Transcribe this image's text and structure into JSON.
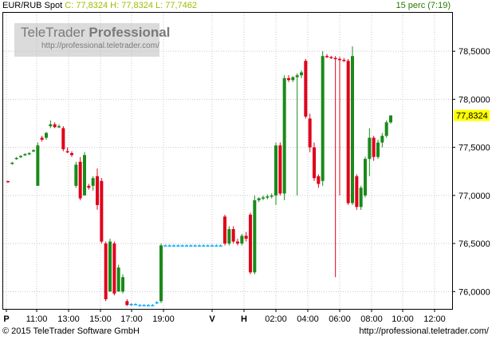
{
  "header": {
    "symbol": "EUR/RUB Spot",
    "quote": "C: 77,8324 H: 77,8324 L: 77,7462",
    "interval": "15 perc (7:19)"
  },
  "logo": {
    "name_regular": "TeleTrader ",
    "name_bold": "Professional",
    "url": "http://professional.teletrader.com/"
  },
  "footer": {
    "copyright": "© 2015 TeleTrader Software GmbH",
    "url": "http://professional.teletrader.com/"
  },
  "colors": {
    "up": "#1a8a1a",
    "down": "#e0001a",
    "doji": "#00aaff",
    "grid": "#c8c8c8",
    "price_highlight": "#ffff00"
  },
  "chart_data": {
    "type": "candlestick",
    "y_ticks": [
      "78,5000",
      "78,0000",
      "77,5000",
      "77,0000",
      "76,5000",
      "76,0000"
    ],
    "y_tick_values": [
      78.5,
      78.0,
      77.5,
      77.0,
      76.5,
      76.0
    ],
    "ylim": [
      75.82,
      78.9
    ],
    "current_price": "77,8324",
    "current_price_value": 77.8324,
    "x_tick_labels": [
      "P",
      "11:00",
      "13:00",
      "15:00",
      "17:00",
      "19:00",
      "V",
      "H",
      "02:00",
      "04:00",
      "06:00",
      "08:00",
      "10:00",
      "12:00"
    ],
    "grid": true,
    "candles": [
      {
        "o": 77.15,
        "h": 77.15,
        "l": 77.13,
        "c": 77.14
      },
      {
        "o": 77.33,
        "h": 77.35,
        "l": 77.32,
        "c": 77.34
      },
      {
        "o": 77.38,
        "h": 77.4,
        "l": 77.37,
        "c": 77.39
      },
      {
        "o": 77.4,
        "h": 77.42,
        "l": 77.39,
        "c": 77.41
      },
      {
        "o": 77.42,
        "h": 77.44,
        "l": 77.41,
        "c": 77.43
      },
      {
        "o": 77.43,
        "h": 77.45,
        "l": 77.42,
        "c": 77.44
      },
      {
        "o": 77.46,
        "h": 77.48,
        "l": 77.45,
        "c": 77.47
      },
      {
        "o": 77.1,
        "h": 77.55,
        "l": 77.1,
        "c": 77.52
      },
      {
        "o": 77.6,
        "h": 77.62,
        "l": 77.56,
        "c": 77.58
      },
      {
        "o": 77.6,
        "h": 77.66,
        "l": 77.58,
        "c": 77.65
      },
      {
        "o": 77.72,
        "h": 77.78,
        "l": 77.7,
        "c": 77.74
      },
      {
        "o": 77.74,
        "h": 77.76,
        "l": 77.7,
        "c": 77.71
      },
      {
        "o": 77.72,
        "h": 77.74,
        "l": 77.7,
        "c": 77.72
      },
      {
        "o": 77.7,
        "h": 77.72,
        "l": 77.46,
        "c": 77.48
      },
      {
        "o": 77.46,
        "h": 77.5,
        "l": 77.44,
        "c": 77.45
      },
      {
        "o": 77.44,
        "h": 77.46,
        "l": 77.4,
        "c": 77.42
      },
      {
        "o": 77.1,
        "h": 77.35,
        "l": 77.08,
        "c": 77.32
      },
      {
        "o": 77.35,
        "h": 77.4,
        "l": 76.95,
        "c": 76.97
      },
      {
        "o": 77.0,
        "h": 77.45,
        "l": 77.0,
        "c": 77.42
      },
      {
        "o": 77.1,
        "h": 77.12,
        "l": 77.06,
        "c": 77.08
      },
      {
        "o": 77.1,
        "h": 77.2,
        "l": 77.05,
        "c": 77.18
      },
      {
        "o": 77.2,
        "h": 77.28,
        "l": 76.85,
        "c": 76.9
      },
      {
        "o": 77.15,
        "h": 77.18,
        "l": 76.5,
        "c": 76.52
      },
      {
        "o": 76.5,
        "h": 76.52,
        "l": 75.9,
        "c": 75.92
      },
      {
        "o": 76.0,
        "h": 76.55,
        "l": 76.0,
        "c": 76.52
      },
      {
        "o": 76.5,
        "h": 76.52,
        "l": 75.96,
        "c": 75.98
      },
      {
        "o": 76.0,
        "h": 76.28,
        "l": 76.0,
        "c": 76.25
      },
      {
        "o": 76.0,
        "h": 76.18,
        "l": 75.98,
        "c": 76.15
      },
      {
        "o": 75.9,
        "h": 75.92,
        "l": 75.85,
        "c": 75.86
      },
      {
        "o": 75.87,
        "h": 75.88,
        "l": 75.85,
        "c": 75.86
      },
      {
        "o": 75.87,
        "h": 75.88,
        "l": 75.86,
        "c": 75.87
      },
      {
        "o": 75.86,
        "h": 75.87,
        "l": 75.85,
        "c": 75.86
      },
      {
        "o": 75.86,
        "h": 75.87,
        "l": 75.85,
        "c": 75.86
      },
      {
        "o": 75.86,
        "h": 75.87,
        "l": 75.85,
        "c": 75.86
      },
      {
        "o": 75.86,
        "h": 75.87,
        "l": 75.85,
        "c": 75.86
      },
      {
        "o": 75.88,
        "h": 75.9,
        "l": 75.87,
        "c": 75.89
      },
      {
        "o": 75.9,
        "h": 76.5,
        "l": 75.88,
        "c": 76.48
      },
      {
        "o": 76.48,
        "h": 76.49,
        "l": 76.47,
        "c": 76.48
      },
      {
        "o": 76.48,
        "h": 76.49,
        "l": 76.47,
        "c": 76.48
      },
      {
        "o": 76.48,
        "h": 76.49,
        "l": 76.47,
        "c": 76.48
      },
      {
        "o": 76.48,
        "h": 76.49,
        "l": 76.47,
        "c": 76.48
      },
      {
        "o": 76.48,
        "h": 76.49,
        "l": 76.47,
        "c": 76.48
      },
      {
        "o": 76.48,
        "h": 76.49,
        "l": 76.47,
        "c": 76.48
      },
      {
        "o": 76.48,
        "h": 76.49,
        "l": 76.47,
        "c": 76.48
      },
      {
        "o": 76.48,
        "h": 76.49,
        "l": 76.47,
        "c": 76.48
      },
      {
        "o": 76.48,
        "h": 76.49,
        "l": 76.47,
        "c": 76.48
      },
      {
        "o": 76.48,
        "h": 76.49,
        "l": 76.47,
        "c": 76.48
      },
      {
        "o": 76.48,
        "h": 76.49,
        "l": 76.47,
        "c": 76.48
      },
      {
        "o": 76.48,
        "h": 76.49,
        "l": 76.47,
        "c": 76.48
      },
      {
        "o": 76.48,
        "h": 76.49,
        "l": 76.47,
        "c": 76.48
      },
      {
        "o": 76.48,
        "h": 76.49,
        "l": 76.47,
        "c": 76.48
      },
      {
        "o": 76.78,
        "h": 76.8,
        "l": 76.48,
        "c": 76.5
      },
      {
        "o": 76.5,
        "h": 76.68,
        "l": 76.48,
        "c": 76.65
      },
      {
        "o": 76.65,
        "h": 76.68,
        "l": 76.5,
        "c": 76.52
      },
      {
        "o": 76.52,
        "h": 76.55,
        "l": 76.48,
        "c": 76.5
      },
      {
        "o": 76.5,
        "h": 76.6,
        "l": 76.48,
        "c": 76.58
      },
      {
        "o": 76.58,
        "h": 76.62,
        "l": 76.52,
        "c": 76.55
      },
      {
        "o": 76.8,
        "h": 76.82,
        "l": 76.18,
        "c": 76.2
      },
      {
        "o": 76.2,
        "h": 77.0,
        "l": 76.18,
        "c": 76.95
      },
      {
        "o": 76.95,
        "h": 76.98,
        "l": 76.93,
        "c": 76.97
      },
      {
        "o": 76.97,
        "h": 77.0,
        "l": 76.95,
        "c": 76.98
      },
      {
        "o": 76.98,
        "h": 77.01,
        "l": 76.96,
        "c": 76.99
      },
      {
        "o": 76.99,
        "h": 77.02,
        "l": 76.97,
        "c": 77.0
      },
      {
        "o": 77.0,
        "h": 77.55,
        "l": 76.9,
        "c": 77.52
      },
      {
        "o": 77.52,
        "h": 77.55,
        "l": 77.0,
        "c": 77.02
      },
      {
        "o": 77.02,
        "h": 78.25,
        "l": 76.95,
        "c": 78.22
      },
      {
        "o": 78.22,
        "h": 78.25,
        "l": 78.18,
        "c": 78.2
      },
      {
        "o": 78.2,
        "h": 78.24,
        "l": 78.18,
        "c": 78.23
      },
      {
        "o": 78.23,
        "h": 78.27,
        "l": 77.0,
        "c": 78.25
      },
      {
        "o": 78.25,
        "h": 78.3,
        "l": 78.22,
        "c": 78.28
      },
      {
        "o": 78.4,
        "h": 78.42,
        "l": 77.8,
        "c": 77.82
      },
      {
        "o": 77.8,
        "h": 77.85,
        "l": 77.45,
        "c": 77.5
      },
      {
        "o": 77.5,
        "h": 77.55,
        "l": 77.15,
        "c": 77.18
      },
      {
        "o": 77.2,
        "h": 77.22,
        "l": 77.08,
        "c": 77.12
      },
      {
        "o": 77.15,
        "h": 78.5,
        "l": 77.1,
        "c": 78.45
      },
      {
        "o": 78.45,
        "h": 78.47,
        "l": 78.43,
        "c": 78.44
      },
      {
        "o": 78.44,
        "h": 78.45,
        "l": 78.42,
        "c": 78.43
      },
      {
        "o": 78.43,
        "h": 78.45,
        "l": 76.15,
        "c": 78.42
      },
      {
        "o": 78.42,
        "h": 78.44,
        "l": 77.0,
        "c": 78.41
      },
      {
        "o": 78.41,
        "h": 78.43,
        "l": 78.39,
        "c": 78.4
      },
      {
        "o": 78.4,
        "h": 78.42,
        "l": 76.9,
        "c": 76.92
      },
      {
        "o": 76.92,
        "h": 78.55,
        "l": 76.9,
        "c": 78.45
      },
      {
        "o": 77.2,
        "h": 77.22,
        "l": 76.85,
        "c": 76.88
      },
      {
        "o": 76.88,
        "h": 77.1,
        "l": 76.85,
        "c": 77.08
      },
      {
        "o": 77.0,
        "h": 77.4,
        "l": 76.98,
        "c": 77.38
      },
      {
        "o": 77.38,
        "h": 77.7,
        "l": 77.2,
        "c": 77.6
      },
      {
        "o": 77.6,
        "h": 77.62,
        "l": 77.36,
        "c": 77.4
      },
      {
        "o": 77.4,
        "h": 77.58,
        "l": 77.38,
        "c": 77.55
      },
      {
        "o": 77.55,
        "h": 77.65,
        "l": 77.5,
        "c": 77.62
      },
      {
        "o": 77.62,
        "h": 77.78,
        "l": 77.6,
        "c": 77.76
      },
      {
        "o": 77.76,
        "h": 77.8324,
        "l": 77.7462,
        "c": 77.8324
      }
    ]
  }
}
